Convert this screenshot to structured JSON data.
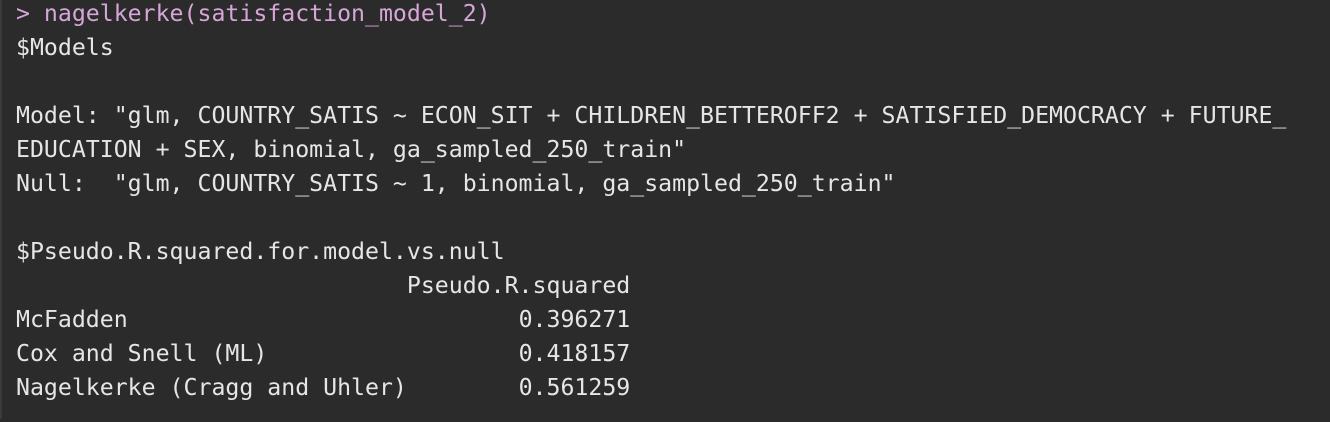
{
  "console": {
    "prompt_symbol": "> ",
    "command": "nagelkerke(satisfaction_model_2)",
    "models_header": "$Models",
    "model_line_1": "Model: \"glm, COUNTRY_SATIS ~ ECON_SIT + CHILDREN_BETTEROFF2 + SATISFIED_DEMOCRACY + FUTURE_",
    "model_line_2": "EDUCATION + SEX, binomial, ga_sampled_250_train\"",
    "null_line": "Null:  \"glm, COUNTRY_SATIS ~ 1, binomial, ga_sampled_250_train\"",
    "pseudo_header": "$Pseudo.R.squared.for.model.vs.null",
    "table": {
      "column_header": "                            Pseudo.R.squared",
      "rows": [
        {
          "label": "McFadden                            ",
          "value": "0.396271"
        },
        {
          "label": "Cox and Snell (ML)                  ",
          "value": "0.418157"
        },
        {
          "label": "Nagelkerke (Cragg and Uhler)        ",
          "value": "0.561259"
        }
      ]
    }
  },
  "colors": {
    "background": "#2b2b2b",
    "text": "#e6e6e6",
    "prompt": "#d7a6d8"
  }
}
